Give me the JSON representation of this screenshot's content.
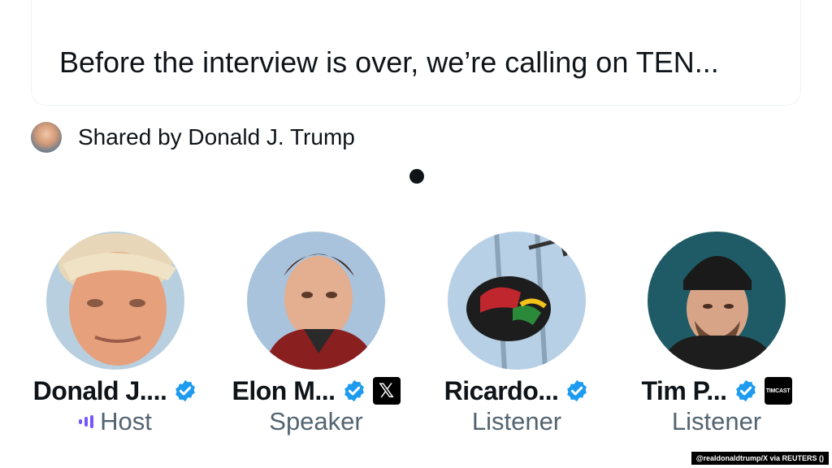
{
  "card": {
    "text": "Before the interview is over, we’re calling on TEN..."
  },
  "shared": {
    "label": "Shared by Donald J. Trump",
    "avatar_icon": "user-avatar"
  },
  "participants": [
    {
      "name": "Donald J....",
      "role": "Host",
      "verified": true,
      "role_icon": "audio-bars-icon",
      "accent": "#7856ff"
    },
    {
      "name": "Elon M...",
      "role": "Speaker",
      "verified": true,
      "affiliation_icon": "x-logo-icon",
      "affiliation_text": "𝕏"
    },
    {
      "name": "Ricardo...",
      "role": "Listener",
      "verified": true
    },
    {
      "name": "Tim P...",
      "role": "Listener",
      "verified": true,
      "affiliation_icon": "timcast-logo-icon",
      "affiliation_text": "TIMCAST"
    }
  ],
  "credit": "@realdonaldtrump/X via REUTERS ()",
  "colors": {
    "verified": "#1d9bf0",
    "secondary_text": "#536471",
    "host_accent": "#7856ff"
  }
}
